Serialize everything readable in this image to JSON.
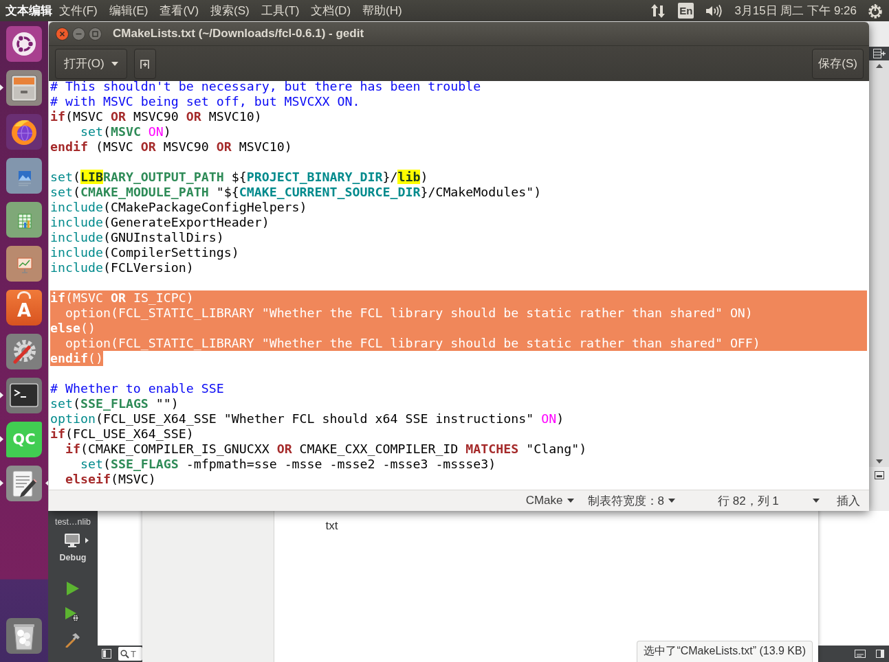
{
  "top_panel": {
    "app_name": "文本编辑",
    "menu": [
      "文件(F)",
      "编辑(E)",
      "查看(V)",
      "搜索(S)",
      "工具(T)",
      "文档(D)",
      "帮助(H)"
    ],
    "keyboard_layout": "En",
    "clock": "3月15日 周二 下午 9:26"
  },
  "launcher": [
    {
      "kind": "dash",
      "running": false,
      "focused": false
    },
    {
      "kind": "files",
      "running": true,
      "focused": false
    },
    {
      "kind": "browser",
      "running": false,
      "focused": false
    },
    {
      "kind": "draw",
      "running": false,
      "focused": false
    },
    {
      "kind": "calc",
      "running": false,
      "focused": false
    },
    {
      "kind": "impress",
      "running": false,
      "focused": false
    },
    {
      "kind": "store",
      "label": "A",
      "running": false,
      "focused": false
    },
    {
      "kind": "settings",
      "running": false,
      "focused": false
    },
    {
      "kind": "terminal",
      "running": true,
      "focused": false
    },
    {
      "kind": "qt",
      "label": "QC",
      "running": true,
      "focused": false
    },
    {
      "kind": "editor",
      "running": true,
      "focused": true
    },
    {
      "kind": "trash",
      "running": false,
      "focused": false
    }
  ],
  "gedit": {
    "title": "CMakeLists.txt (~/Downloads/fcl-0.6.1) - gedit",
    "open_button": "打开(O)",
    "save_button": "保存(S)",
    "lines": [
      {
        "selected": false,
        "segments": [
          {
            "kind": "comment",
            "text": "# This shouldn't be necessary, but there has been trouble"
          }
        ]
      },
      {
        "selected": false,
        "segments": [
          {
            "kind": "comment",
            "text": "# with MSVC being set off, but MSVCXX ON."
          }
        ]
      },
      {
        "selected": false,
        "segments": [
          {
            "kind": "keyword",
            "text": "if"
          },
          {
            "kind": "plain",
            "text": "(MSVC "
          },
          {
            "kind": "keyword",
            "text": "OR"
          },
          {
            "kind": "plain",
            "text": " MSVC90 "
          },
          {
            "kind": "keyword",
            "text": "OR"
          },
          {
            "kind": "plain",
            "text": " MSVC10)"
          }
        ]
      },
      {
        "selected": false,
        "segments": [
          {
            "kind": "command",
            "text": "    set"
          },
          {
            "kind": "plain",
            "text": "("
          },
          {
            "kind": "variable",
            "text": "MSVC"
          },
          {
            "kind": "constant",
            "text": " ON"
          },
          {
            "kind": "plain",
            "text": ")"
          }
        ]
      },
      {
        "selected": false,
        "segments": [
          {
            "kind": "keyword",
            "text": "endif"
          },
          {
            "kind": "plain",
            "text": " (MSVC "
          },
          {
            "kind": "keyword",
            "text": "OR"
          },
          {
            "kind": "plain",
            "text": " MSVC90 "
          },
          {
            "kind": "keyword",
            "text": "OR"
          },
          {
            "kind": "plain",
            "text": " MSVC10)"
          }
        ]
      },
      {
        "selected": false
      },
      {
        "selected": false,
        "segments": [
          {
            "kind": "command",
            "text": "set"
          },
          {
            "kind": "plain",
            "text": "("
          },
          {
            "kind": "match",
            "text": "LIB"
          },
          {
            "kind": "variable",
            "text": "RARY_OUTPUT_PATH"
          },
          {
            "kind": "plain",
            "text": " ${"
          },
          {
            "kind": "builtin",
            "text": "PROJECT_BINARY_DIR"
          },
          {
            "kind": "plain",
            "text": "}/"
          },
          {
            "kind": "match",
            "text": "lib"
          },
          {
            "kind": "plain",
            "text": ")"
          }
        ]
      },
      {
        "selected": false,
        "segments": [
          {
            "kind": "command",
            "text": "set"
          },
          {
            "kind": "plain",
            "text": "("
          },
          {
            "kind": "variable",
            "text": "CMAKE_MODULE_PATH"
          },
          {
            "kind": "plain",
            "text": " \"${"
          },
          {
            "kind": "builtin",
            "text": "CMAKE_CURRENT_SOURCE_DIR"
          },
          {
            "kind": "plain",
            "text": "}/CMakeModules\")"
          }
        ]
      },
      {
        "selected": false,
        "segments": [
          {
            "kind": "command",
            "text": "include"
          },
          {
            "kind": "plain",
            "text": "(CMakePackageConfigHelpers)"
          }
        ]
      },
      {
        "selected": false,
        "segments": [
          {
            "kind": "command",
            "text": "include"
          },
          {
            "kind": "plain",
            "text": "(GenerateExportHeader)"
          }
        ]
      },
      {
        "selected": false,
        "segments": [
          {
            "kind": "command",
            "text": "include"
          },
          {
            "kind": "plain",
            "text": "(GNUInstallDirs)"
          }
        ]
      },
      {
        "selected": false,
        "segments": [
          {
            "kind": "command",
            "text": "include"
          },
          {
            "kind": "plain",
            "text": "(CompilerSettings)"
          }
        ]
      },
      {
        "selected": false,
        "segments": [
          {
            "kind": "command",
            "text": "include"
          },
          {
            "kind": "plain",
            "text": "(FCLVersion)"
          }
        ]
      },
      {
        "selected": false
      },
      {
        "selected": true,
        "segments": [
          {
            "kind": "keyword",
            "text": "if"
          },
          {
            "kind": "plain",
            "text": "(MSVC "
          },
          {
            "kind": "keyword",
            "text": "OR"
          },
          {
            "kind": "plain",
            "text": " IS_ICPC)"
          }
        ]
      },
      {
        "selected": true,
        "segments": [
          {
            "kind": "command",
            "text": "  option"
          },
          {
            "kind": "plain",
            "text": "(FCL_STATIC_LIBRARY \"Whether the FCL library should be static rather than shared\" ON)"
          }
        ]
      },
      {
        "selected": true,
        "segments": [
          {
            "kind": "keyword",
            "text": "else"
          },
          {
            "kind": "plain",
            "text": "()"
          }
        ]
      },
      {
        "selected": true,
        "segments": [
          {
            "kind": "command",
            "text": "  option"
          },
          {
            "kind": "plain",
            "text": "(FCL_STATIC_LIBRARY \"Whether the FCL library should be static rather than shared\" OFF)"
          }
        ]
      },
      {
        "selected": true,
        "segments": [
          {
            "kind": "keyword",
            "text": "endif"
          },
          {
            "kind": "plain",
            "text": "()"
          }
        ]
      },
      {
        "selected": false
      },
      {
        "selected": false,
        "segments": [
          {
            "kind": "comment",
            "text": "# Whether to enable SSE"
          }
        ]
      },
      {
        "selected": false,
        "segments": [
          {
            "kind": "command",
            "text": "set"
          },
          {
            "kind": "plain",
            "text": "("
          },
          {
            "kind": "variable",
            "text": "SSE_FLAGS"
          },
          {
            "kind": "plain",
            "text": " \"\")"
          }
        ]
      },
      {
        "selected": false,
        "segments": [
          {
            "kind": "command",
            "text": "option"
          },
          {
            "kind": "plain",
            "text": "(FCL_USE_X64_SSE \"Whether FCL should x64 SSE instructions\" "
          },
          {
            "kind": "constant",
            "text": "ON"
          },
          {
            "kind": "plain",
            "text": ")"
          }
        ]
      },
      {
        "selected": false,
        "segments": [
          {
            "kind": "keyword",
            "text": "if"
          },
          {
            "kind": "plain",
            "text": "(FCL_USE_X64_SSE)"
          }
        ]
      },
      {
        "selected": false,
        "segments": [
          {
            "kind": "keyword",
            "text": "  if"
          },
          {
            "kind": "plain",
            "text": "(CMAKE_COMPILER_IS_GNUCXX "
          },
          {
            "kind": "keyword",
            "text": "OR"
          },
          {
            "kind": "plain",
            "text": " CMAKE_CXX_COMPILER_ID "
          },
          {
            "kind": "keyword",
            "text": "MATCHES"
          },
          {
            "kind": "plain",
            "text": " \"Clang\")"
          }
        ]
      },
      {
        "selected": false,
        "segments": [
          {
            "kind": "command",
            "text": "    set"
          },
          {
            "kind": "plain",
            "text": "("
          },
          {
            "kind": "variable",
            "text": "SSE_FLAGS"
          },
          {
            "kind": "plain",
            "text": " -mfpmath=sse -msse -msse2 -msse3 -mssse3)"
          }
        ]
      },
      {
        "selected": false,
        "segments": [
          {
            "kind": "keyword",
            "text": "  elseif"
          },
          {
            "kind": "plain",
            "text": "(MSVC)"
          }
        ]
      }
    ],
    "status_bar": {
      "language": "CMake",
      "tab_width": "制表符宽度：8",
      "cursor_position": "行 82，列 1",
      "mode": "插入"
    }
  },
  "qt_creator": {
    "project": "test…nlib",
    "build_configuration": "Debug",
    "locator_placeholder": "T"
  },
  "file_manager": {
    "files": [
      "txt"
    ],
    "selection_status": "选中了“CMakeLists.txt” (13.9 KB)"
  }
}
